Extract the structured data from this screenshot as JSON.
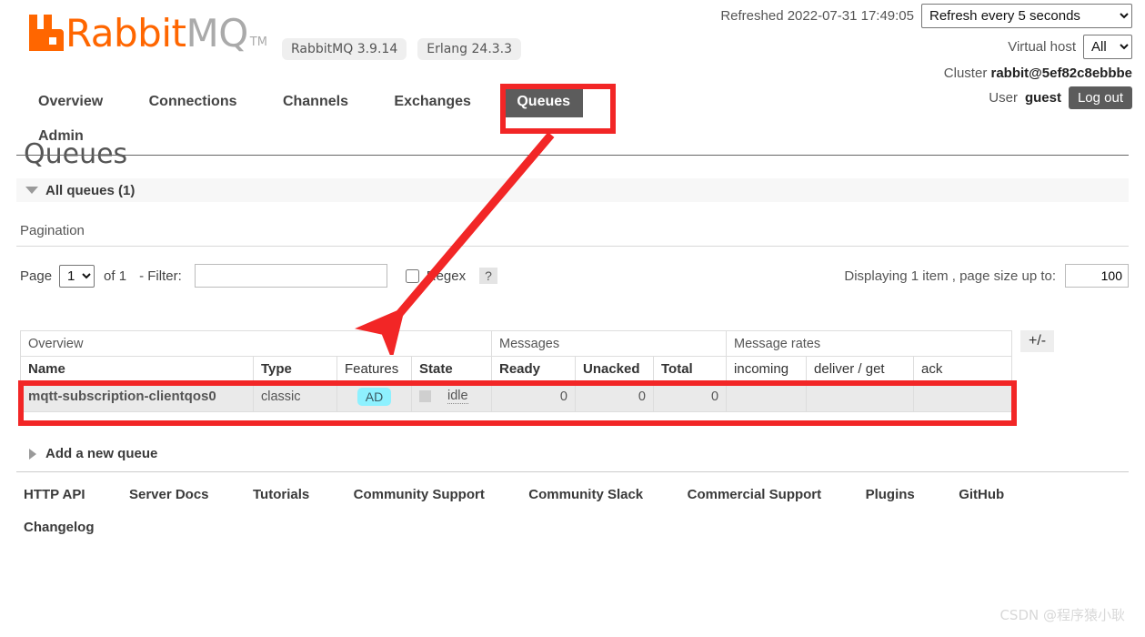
{
  "brand": {
    "name_first": "Rabbit",
    "name_second": "MQ",
    "tm": "TM",
    "badges": [
      "RabbitMQ 3.9.14",
      "Erlang 24.3.3"
    ]
  },
  "header": {
    "refreshed_label": "Refreshed 2022-07-31 17:49:05",
    "refresh_select": "Refresh every 5 seconds",
    "vhost_label": "Virtual host",
    "vhost_select": "All",
    "cluster_label": "Cluster",
    "cluster_name": "rabbit@5ef82c8ebbbe",
    "user_label": "User",
    "user_name": "guest",
    "logout_label": "Log out"
  },
  "nav": {
    "items": [
      {
        "label": "Overview",
        "active": false
      },
      {
        "label": "Connections",
        "active": false
      },
      {
        "label": "Channels",
        "active": false
      },
      {
        "label": "Exchanges",
        "active": false
      },
      {
        "label": "Queues",
        "active": true
      },
      {
        "label": "Admin",
        "active": false
      }
    ]
  },
  "page": {
    "title": "Queues",
    "section_label": "All queues (1)",
    "pagination_label": "Pagination"
  },
  "pagination": {
    "page_label": "Page",
    "page_value": "1",
    "of_label": "of 1",
    "filter_label": "- Filter:",
    "filter_value": "",
    "regex_label": "Regex",
    "help_label": "?",
    "displaying_label": "Displaying 1 item , page size up to:",
    "page_size_value": "100"
  },
  "table": {
    "group_headers": [
      {
        "label": "Overview",
        "span": 4
      },
      {
        "label": "Messages",
        "span": 3
      },
      {
        "label": "Message rates",
        "span": 3
      }
    ],
    "columns": [
      {
        "label": "Name",
        "bold": true,
        "align": "left"
      },
      {
        "label": "Type",
        "bold": true,
        "align": "left"
      },
      {
        "label": "Features",
        "bold": false,
        "align": "left"
      },
      {
        "label": "State",
        "bold": true,
        "align": "left"
      },
      {
        "label": "Ready",
        "bold": true,
        "align": "left"
      },
      {
        "label": "Unacked",
        "bold": true,
        "align": "left"
      },
      {
        "label": "Total",
        "bold": true,
        "align": "left"
      },
      {
        "label": "incoming",
        "bold": false,
        "align": "left"
      },
      {
        "label": "deliver / get",
        "bold": false,
        "align": "left"
      },
      {
        "label": "ack",
        "bold": false,
        "align": "left"
      }
    ],
    "rows": [
      {
        "name": "mqtt-subscription-clientqos0",
        "type": "classic",
        "features": "AD",
        "state": "idle",
        "ready": "0",
        "unacked": "0",
        "total": "0",
        "incoming": "",
        "deliver_get": "",
        "ack": ""
      }
    ],
    "toggle_columns_label": "+/-"
  },
  "add_queue": {
    "label": "Add a new queue"
  },
  "footer": {
    "links_row1": [
      "HTTP API",
      "Server Docs",
      "Tutorials",
      "Community Support",
      "Community Slack",
      "Commercial Support",
      "Plugins",
      "GitHub"
    ],
    "links_row2": [
      "Changelog"
    ]
  },
  "watermark": {
    "text": "CSDN @程序猿小耿"
  },
  "colors": {
    "brand_orange": "#FF6600",
    "annotation_red": "#F22626",
    "active_tab_bg": "#5C5C5C",
    "feature_badge_bg": "#8EF1FF"
  }
}
